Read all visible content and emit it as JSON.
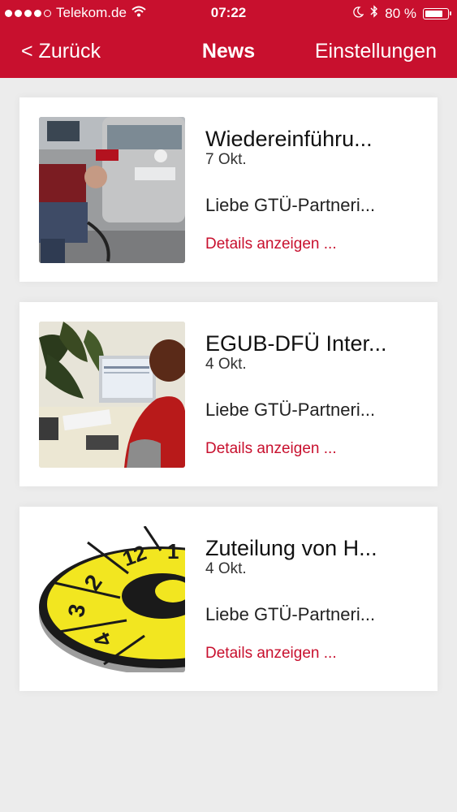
{
  "status": {
    "carrier": "Telekom.de",
    "time": "07:22",
    "battery": "80 %",
    "battery_level": 0.8,
    "signal_icon": "signal-dots-icon",
    "wifi_icon": "wifi-icon"
  },
  "nav": {
    "back_label": "< Zurück",
    "title": "News",
    "settings_label": "Einstellungen"
  },
  "colors": {
    "brand": "#c8102e",
    "background": "#ececec",
    "link": "#c8102e"
  },
  "news": [
    {
      "title": "Wiedereinführu...",
      "date": "7 Okt.",
      "snippet": "Liebe GTÜ-Partneri...",
      "link": "Details anzeigen ...",
      "image": "mechanic-exhaust-test-photo"
    },
    {
      "title": "EGUB-DFÜ Inter...",
      "date": "4 Okt.",
      "snippet": "Liebe GTÜ-Partneri...",
      "link": "Details anzeigen ...",
      "image": "person-at-computer-photo"
    },
    {
      "title": "Zuteilung von H...",
      "date": "4 Okt.",
      "snippet": "Liebe GTÜ-Partneri...",
      "link": "Details anzeigen ...",
      "image": "inspection-sticker-image",
      "sticker_numbers": [
        "12",
        "1",
        "2",
        "3",
        "4"
      ]
    }
  ]
}
